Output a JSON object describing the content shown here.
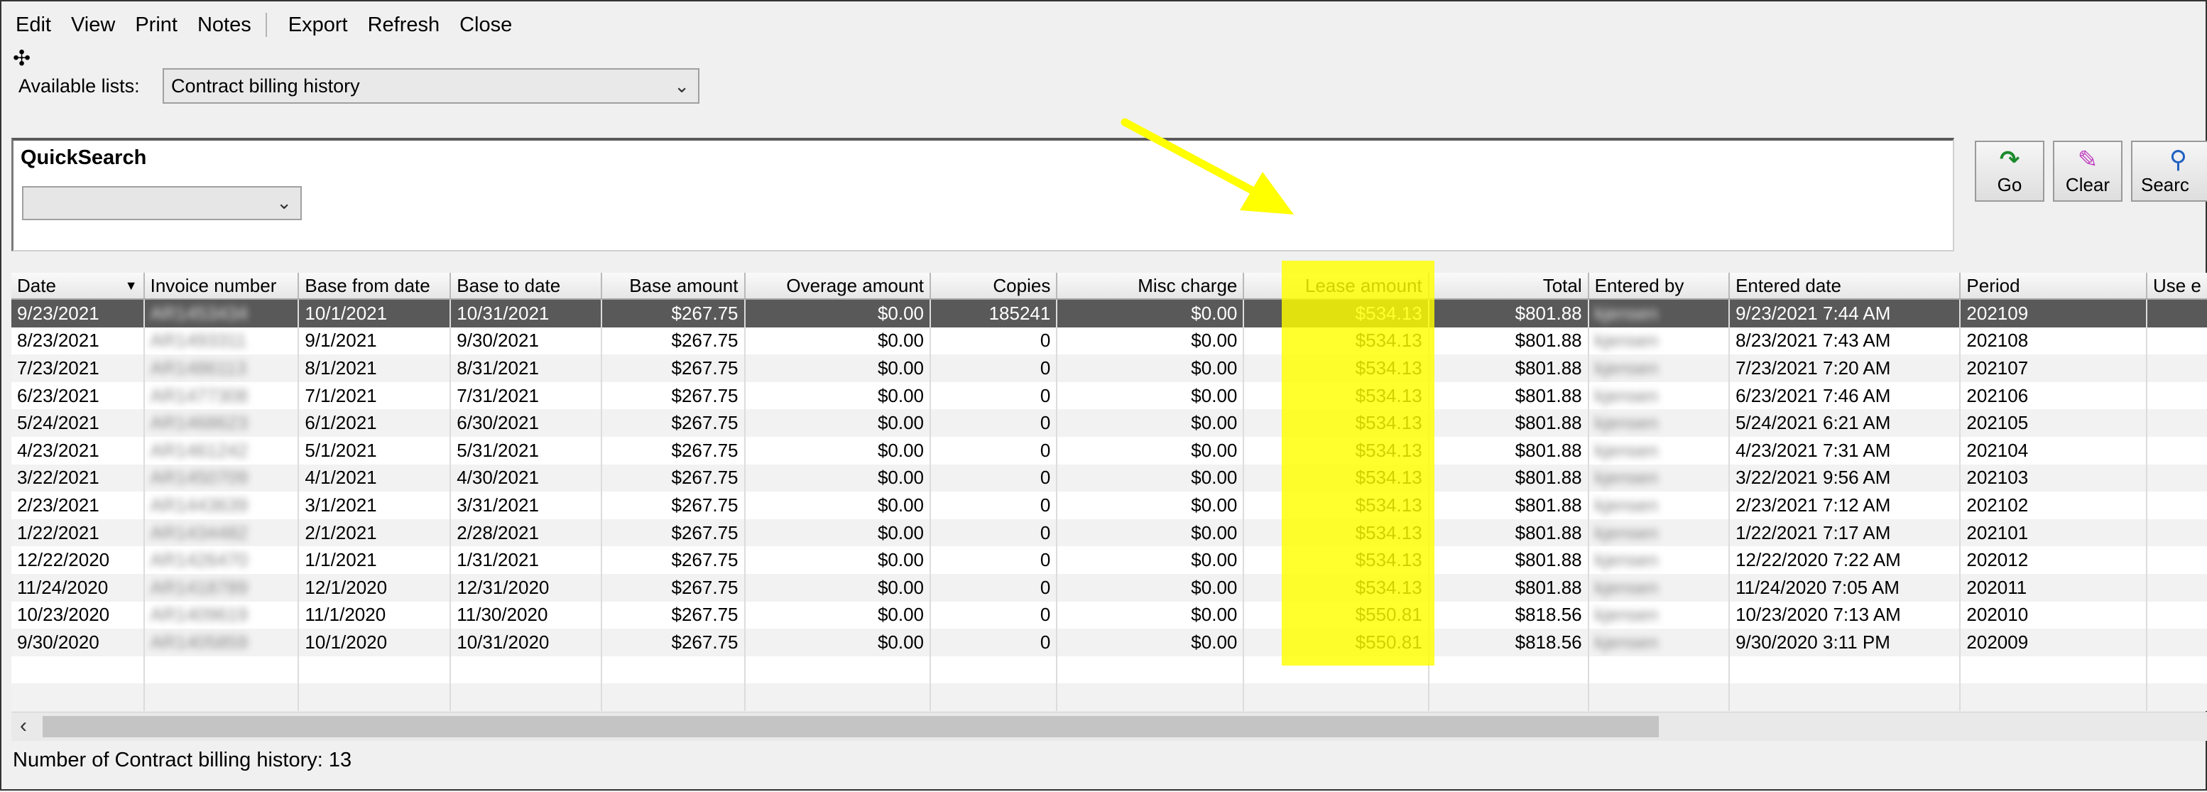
{
  "menu": [
    "Edit",
    "View",
    "Print",
    "Notes",
    "Export",
    "Refresh",
    "Close"
  ],
  "lists": {
    "label": "Available lists:",
    "selected": "Contract billing history"
  },
  "quicksearch": {
    "title": "QuickSearch",
    "value": ""
  },
  "buttons": {
    "go": "Go",
    "clear": "Clear",
    "search": "Searc"
  },
  "table": {
    "columns": [
      "Date",
      "Invoice number",
      "Base from date",
      "Base to date",
      "Base amount",
      "Overage amount",
      "Copies",
      "Misc charge",
      "Lease amount",
      "Total",
      "Entered by",
      "Entered date",
      "Period",
      "Use e"
    ],
    "rows": [
      [
        "9/23/2021",
        "AR1453434",
        "10/1/2021",
        "10/31/2021",
        "$267.75",
        "$0.00",
        "185241",
        "$0.00",
        "$534.13",
        "$801.88",
        "kjensen",
        "9/23/2021 7:44 AM",
        "202109"
      ],
      [
        "8/23/2021",
        "AR1493311",
        "9/1/2021",
        "9/30/2021",
        "$267.75",
        "$0.00",
        "0",
        "$0.00",
        "$534.13",
        "$801.88",
        "kjensen",
        "8/23/2021 7:43 AM",
        "202108"
      ],
      [
        "7/23/2021",
        "AR1486113",
        "8/1/2021",
        "8/31/2021",
        "$267.75",
        "$0.00",
        "0",
        "$0.00",
        "$534.13",
        "$801.88",
        "kjensen",
        "7/23/2021 7:20 AM",
        "202107"
      ],
      [
        "6/23/2021",
        "AR1477308",
        "7/1/2021",
        "7/31/2021",
        "$267.75",
        "$0.00",
        "0",
        "$0.00",
        "$534.13",
        "$801.88",
        "kjensen",
        "6/23/2021 7:46 AM",
        "202106"
      ],
      [
        "5/24/2021",
        "AR1468623",
        "6/1/2021",
        "6/30/2021",
        "$267.75",
        "$0.00",
        "0",
        "$0.00",
        "$534.13",
        "$801.88",
        "kjensen",
        "5/24/2021 6:21 AM",
        "202105"
      ],
      [
        "4/23/2021",
        "AR1461242",
        "5/1/2021",
        "5/31/2021",
        "$267.75",
        "$0.00",
        "0",
        "$0.00",
        "$534.13",
        "$801.88",
        "kjensen",
        "4/23/2021 7:31 AM",
        "202104"
      ],
      [
        "3/22/2021",
        "AR1450709",
        "4/1/2021",
        "4/30/2021",
        "$267.75",
        "$0.00",
        "0",
        "$0.00",
        "$534.13",
        "$801.88",
        "kjensen",
        "3/22/2021 9:56 AM",
        "202103"
      ],
      [
        "2/23/2021",
        "AR1443639",
        "3/1/2021",
        "3/31/2021",
        "$267.75",
        "$0.00",
        "0",
        "$0.00",
        "$534.13",
        "$801.88",
        "kjensen",
        "2/23/2021 7:12 AM",
        "202102"
      ],
      [
        "1/22/2021",
        "AR1434482",
        "2/1/2021",
        "2/28/2021",
        "$267.75",
        "$0.00",
        "0",
        "$0.00",
        "$534.13",
        "$801.88",
        "kjensen",
        "1/22/2021 7:17 AM",
        "202101"
      ],
      [
        "12/22/2020",
        "AR1426470",
        "1/1/2021",
        "1/31/2021",
        "$267.75",
        "$0.00",
        "0",
        "$0.00",
        "$534.13",
        "$801.88",
        "kjensen",
        "12/22/2020 7:22 AM",
        "202012"
      ],
      [
        "11/24/2020",
        "AR1418789",
        "12/1/2020",
        "12/31/2020",
        "$267.75",
        "$0.00",
        "0",
        "$0.00",
        "$534.13",
        "$801.88",
        "kjensen",
        "11/24/2020 7:05 AM",
        "202011"
      ],
      [
        "10/23/2020",
        "AR1409619",
        "11/1/2020",
        "11/30/2020",
        "$267.75",
        "$0.00",
        "0",
        "$0.00",
        "$550.81",
        "$818.56",
        "kjensen",
        "10/23/2020 7:13 AM",
        "202010"
      ],
      [
        "9/30/2020",
        "AR1405859",
        "10/1/2020",
        "10/31/2020",
        "$267.75",
        "$0.00",
        "0",
        "$0.00",
        "$550.81",
        "$818.56",
        "kjensen",
        "9/30/2020 3:11 PM",
        "202009"
      ]
    ]
  },
  "status": "Number of Contract billing history: 13",
  "colors": {
    "highlight": "#ffff00",
    "selected_row": "#595959",
    "annotation_arrow": "#ffff00"
  },
  "icons": {
    "go": "green-curved-arrow-icon",
    "clear": "eraser-icon",
    "search": "magnifier-icon",
    "cursor": "move-cursor-icon"
  }
}
